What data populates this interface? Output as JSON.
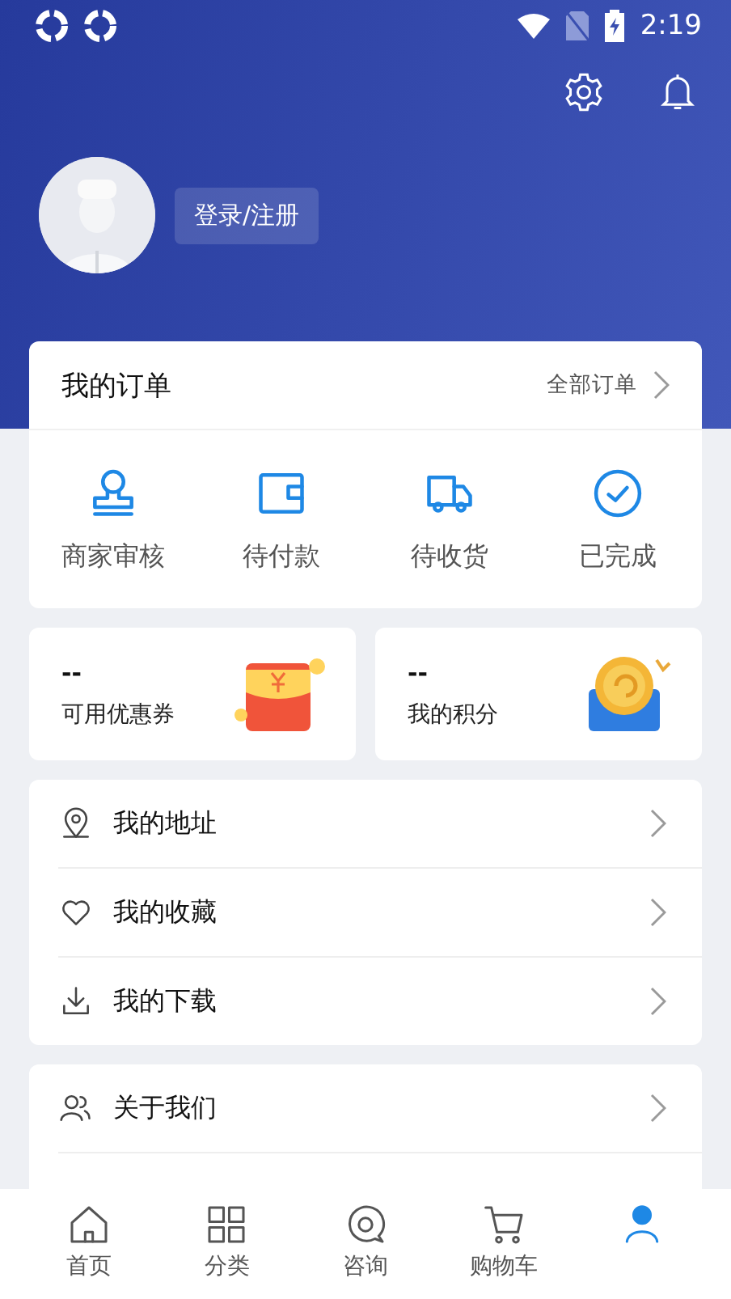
{
  "status_bar": {
    "time": "2:19"
  },
  "header": {
    "login_button": "登录/注册"
  },
  "orders": {
    "title": "我的订单",
    "all_link": "全部订单",
    "items": [
      {
        "kind": "stamp",
        "label": "商家审核"
      },
      {
        "kind": "wallet",
        "label": "待付款"
      },
      {
        "kind": "truck",
        "label": "待收货"
      },
      {
        "kind": "check",
        "label": "已完成"
      }
    ]
  },
  "assets": [
    {
      "kind": "coupon",
      "value": "--",
      "label": "可用优惠券"
    },
    {
      "kind": "points",
      "value": "--",
      "label": "我的积分"
    }
  ],
  "menu_groups": [
    [
      {
        "kind": "pin",
        "label": "我的地址"
      },
      {
        "kind": "heart",
        "label": "我的收藏"
      },
      {
        "kind": "download",
        "label": "我的下载"
      }
    ],
    [
      {
        "kind": "people",
        "label": "关于我们"
      }
    ]
  ],
  "tab_bar": [
    {
      "kind": "home",
      "label": "首页",
      "selected": false
    },
    {
      "kind": "grid",
      "label": "分类",
      "selected": false
    },
    {
      "kind": "chat",
      "label": "咨询",
      "selected": false
    },
    {
      "kind": "cart",
      "label": "购物车",
      "selected": false
    },
    {
      "kind": "person",
      "selected": true
    }
  ]
}
